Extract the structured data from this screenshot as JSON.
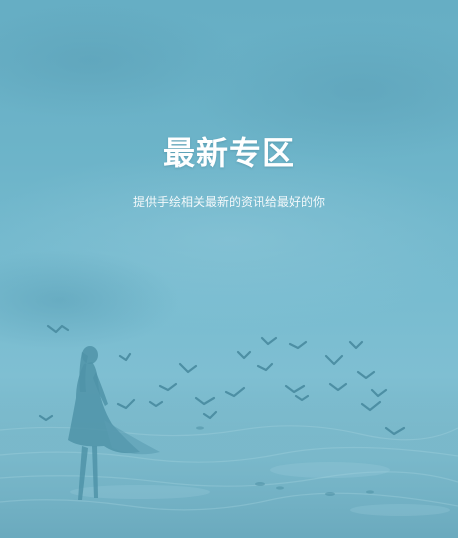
{
  "banner": {
    "title": "最新专区",
    "subtitle": "提供手绘相关最新的资讯给最好的你"
  },
  "colors": {
    "sky_top": "#66aec4",
    "sea": "#7fbfd2",
    "text": "#ffffff",
    "silhouette": "#4f93a8"
  }
}
